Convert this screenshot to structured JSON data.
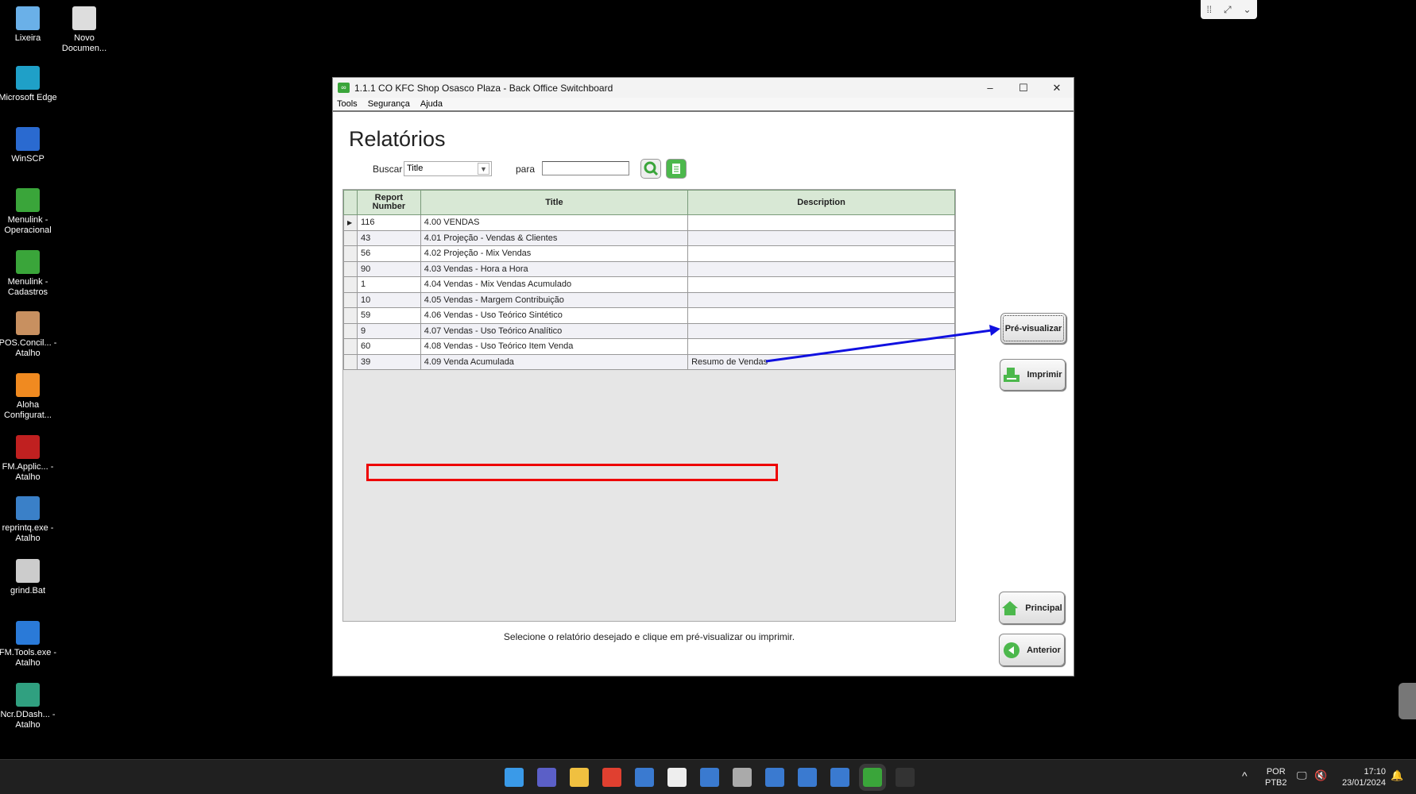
{
  "desktop": {
    "icons": [
      {
        "label": "Lixeira",
        "color": "#6ab0e8"
      },
      {
        "label": "Novo Documen...",
        "color": "#ddd"
      },
      {
        "label": "Microsoft Edge",
        "color": "#1fa0c8"
      },
      {
        "label": "WinSCP",
        "color": "#2a6ad0"
      },
      {
        "label": "Menulink - Operacional",
        "color": "#3aa53a"
      },
      {
        "label": "Menulink - Cadastros",
        "color": "#3aa53a"
      },
      {
        "label": "POS.Concil... - Atalho",
        "color": "#c89060"
      },
      {
        "label": "Aloha Configurat...",
        "color": "#f08a20"
      },
      {
        "label": "FM.Applic... - Atalho",
        "color": "#c02020"
      },
      {
        "label": "reprintq.exe - Atalho",
        "color": "#3a80c8"
      },
      {
        "label": "grind.Bat",
        "color": "#ccc"
      },
      {
        "label": "FM.Tools.exe - Atalho",
        "color": "#2a7ad8"
      },
      {
        "label": "Ncr.DDash... - Atalho",
        "color": "#30a080"
      }
    ]
  },
  "window": {
    "title": "1.1.1 CO KFC Shop Osasco Plaza - Back Office Switchboard",
    "menu": [
      "Tools",
      "Segurança",
      "Ajuda"
    ],
    "heading": "Relatórios",
    "search": {
      "label": "Buscar",
      "field": "Title",
      "para_label": "para",
      "value": ""
    },
    "grid": {
      "columns": [
        "Report Number",
        "Title",
        "Description"
      ],
      "rows": [
        {
          "number": "116",
          "title": "4.00 VENDAS",
          "description": ""
        },
        {
          "number": "43",
          "title": "4.01 Projeção - Vendas & Clientes",
          "description": ""
        },
        {
          "number": "56",
          "title": "4.02 Projeção - Mix Vendas",
          "description": ""
        },
        {
          "number": "90",
          "title": "4.03 Vendas - Hora a Hora",
          "description": ""
        },
        {
          "number": "1",
          "title": "4.04 Vendas - Mix Vendas Acumulado",
          "description": ""
        },
        {
          "number": "10",
          "title": "4.05 Vendas - Margem Contribuição",
          "description": ""
        },
        {
          "number": "59",
          "title": "4.06 Vendas - Uso Teórico Sintético",
          "description": ""
        },
        {
          "number": "9",
          "title": "4.07 Vendas - Uso Teórico Analítico",
          "description": ""
        },
        {
          "number": "60",
          "title": "4.08 Vendas - Uso Teórico Item Venda",
          "description": ""
        },
        {
          "number": "39",
          "title": "4.09 Venda Acumulada",
          "description": "Resumo de Vendas"
        }
      ]
    },
    "buttons": {
      "preview": "Pré-visualizar",
      "print": "Imprimir",
      "main": "Principal",
      "back": "Anterior"
    },
    "status": "Selecione o relatório desejado e clique em pré-visualizar ou imprimir."
  },
  "taskbar": {
    "apps": [
      "start",
      "teams",
      "file-explorer",
      "chrome",
      "app",
      "vnc",
      "app",
      "settings",
      "app",
      "app",
      "app",
      "menulink",
      "terminal"
    ],
    "lang": "POR",
    "layout": "PTB2",
    "time": "17:10",
    "date": "23/01/2024"
  },
  "colors": {
    "highlight": "#e00000",
    "arrow": "#1010e0",
    "header": "#d8e8d5",
    "accent": "#3aa53a"
  }
}
